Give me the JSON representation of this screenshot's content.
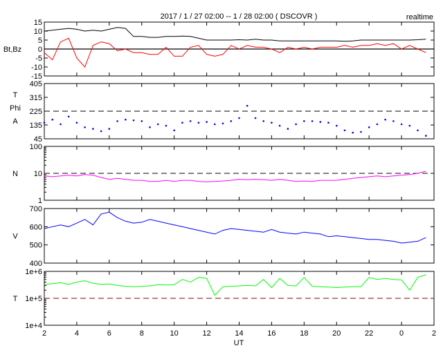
{
  "chart_data": {
    "type": "line",
    "title": "2017 / 1 / 27   02:00 -- 1 / 28   02:00 ( DSCOVR )",
    "badge": "realtime",
    "xlabel": "UT",
    "x_range_hours": [
      2,
      26
    ],
    "x_ticks": [
      "2",
      "4",
      "6",
      "8",
      "10",
      "12",
      "14",
      "16",
      "18",
      "20",
      "22",
      "0",
      "2"
    ],
    "x_step_hours": 0.5,
    "panels": [
      {
        "ylabel": "Bt,Bz",
        "scale": "linear",
        "ylim": [
          -15,
          15
        ],
        "ticks": [
          "15",
          "10",
          "5",
          "0",
          "-5",
          "-10",
          "-15"
        ],
        "tick_values": [
          15,
          10,
          5,
          0,
          -5,
          -10,
          -15
        ],
        "ref_line": 0,
        "ref_style": "solid",
        "series": [
          {
            "name": "Bt",
            "color": "#000000",
            "style": "line",
            "values": [
              10,
              10.5,
              11,
              11.5,
              11,
              10,
              10.5,
              10,
              11,
              12,
              11.5,
              7,
              7,
              6.5,
              6.5,
              7,
              7,
              7.2,
              7,
              6,
              5,
              5,
              5,
              5,
              5.2,
              5,
              5.5,
              5,
              5,
              4.5,
              4.5,
              4.5,
              4.5,
              4.5,
              4.5,
              4.5,
              4.5,
              4.3,
              4.5,
              5,
              5,
              5,
              5,
              5,
              5,
              5,
              5.2,
              5.5
            ]
          },
          {
            "name": "Bz",
            "color": "#ff0000",
            "style": "line",
            "values": [
              -2,
              -6,
              4,
              6,
              -5,
              -10,
              2,
              4,
              3,
              -1,
              0,
              -2,
              -2,
              -3,
              -3,
              1,
              -4,
              -4,
              1,
              2,
              -3,
              -4,
              -3,
              2,
              0,
              2,
              1,
              1,
              0,
              -2,
              1,
              0,
              1,
              0,
              1,
              1,
              1,
              2,
              1,
              2,
              2,
              3,
              2,
              3,
              0,
              2,
              0,
              -2
            ]
          }
        ]
      },
      {
        "ylabel": "T\nPhi\nA",
        "ylabel_lines": [
          "T",
          "Phi",
          "A"
        ],
        "scale": "linear",
        "ylim": [
          45,
          405
        ],
        "ticks": [
          "405",
          "315",
          "225",
          "135",
          "45"
        ],
        "tick_values": [
          405,
          315,
          225,
          135,
          45
        ],
        "ref_line": 225,
        "ref_style": "dashed",
        "series": [
          {
            "name": "Phi",
            "color": "#0000ff",
            "style": "dots",
            "values": [
              150,
              170,
              140,
              190,
              150,
              120,
              110,
              95,
              110,
              160,
              170,
              165,
              160,
              120,
              140,
              130,
              100,
              150,
              160,
              150,
              155,
              140,
              145,
              160,
              180,
              260,
              180,
              160,
              150,
              130,
              110,
              140,
              160,
              160,
              155,
              150,
              130,
              100,
              85,
              90,
              120,
              140,
              170,
              160,
              140,
              130,
              100,
              65
            ]
          }
        ]
      },
      {
        "ylabel": "N",
        "scale": "log",
        "ylim": [
          1,
          100
        ],
        "ticks": [
          "100",
          "10",
          "1"
        ],
        "tick_values": [
          100,
          10,
          1
        ],
        "ref_line": 10,
        "ref_style": "dashed",
        "series": [
          {
            "name": "N",
            "color": "#ff00ff",
            "style": "line",
            "values": [
              8,
              7.5,
              8,
              8.5,
              8,
              9,
              8.5,
              7,
              6,
              6.5,
              6,
              5.5,
              5.5,
              5,
              5,
              5.5,
              5,
              5.5,
              5.5,
              5,
              4.8,
              5,
              5.2,
              5.5,
              6,
              5.8,
              6,
              5.8,
              5.5,
              6,
              5.5,
              5,
              5.2,
              5,
              5.5,
              5.5,
              5.5,
              6,
              6.5,
              7,
              7.5,
              8,
              7.5,
              8,
              8.5,
              9,
              10,
              12
            ]
          }
        ]
      },
      {
        "ylabel": "V",
        "scale": "linear",
        "ylim": [
          400,
          700
        ],
        "ticks": [
          "700",
          "600",
          "500",
          "400"
        ],
        "tick_values": [
          700,
          600,
          500,
          400
        ],
        "series": [
          {
            "name": "V",
            "color": "#0000ff",
            "style": "line",
            "values": [
              590,
              600,
              610,
              600,
              620,
              640,
              610,
              670,
              680,
              650,
              630,
              620,
              625,
              640,
              630,
              620,
              610,
              600,
              590,
              580,
              570,
              560,
              580,
              590,
              585,
              580,
              575,
              570,
              585,
              570,
              565,
              560,
              570,
              565,
              560,
              545,
              550,
              545,
              540,
              535,
              530,
              530,
              525,
              520,
              510,
              515,
              520,
              540
            ]
          }
        ]
      },
      {
        "ylabel": "T",
        "scale": "log",
        "ylim": [
          10000,
          1000000
        ],
        "ticks": [
          "1e+6",
          "1e+5",
          "1e+4"
        ],
        "tick_values": [
          1000000,
          100000,
          10000
        ],
        "ref_line": 100000,
        "ref_style": "dashed",
        "series": [
          {
            "name": "Tp",
            "color": "#00ff00",
            "style": "line",
            "values": [
              320000,
              350000,
              380000,
              330000,
              400000,
              450000,
              360000,
              330000,
              340000,
              300000,
              280000,
              270000,
              280000,
              290000,
              320000,
              310000,
              320000,
              500000,
              400000,
              600000,
              550000,
              130000,
              270000,
              280000,
              290000,
              300000,
              290000,
              500000,
              250000,
              550000,
              300000,
              290000,
              600000,
              280000,
              270000,
              260000,
              250000,
              260000,
              270000,
              270000,
              600000,
              500000,
              550000,
              500000,
              480000,
              200000,
              600000,
              750000
            ]
          }
        ]
      }
    ]
  }
}
